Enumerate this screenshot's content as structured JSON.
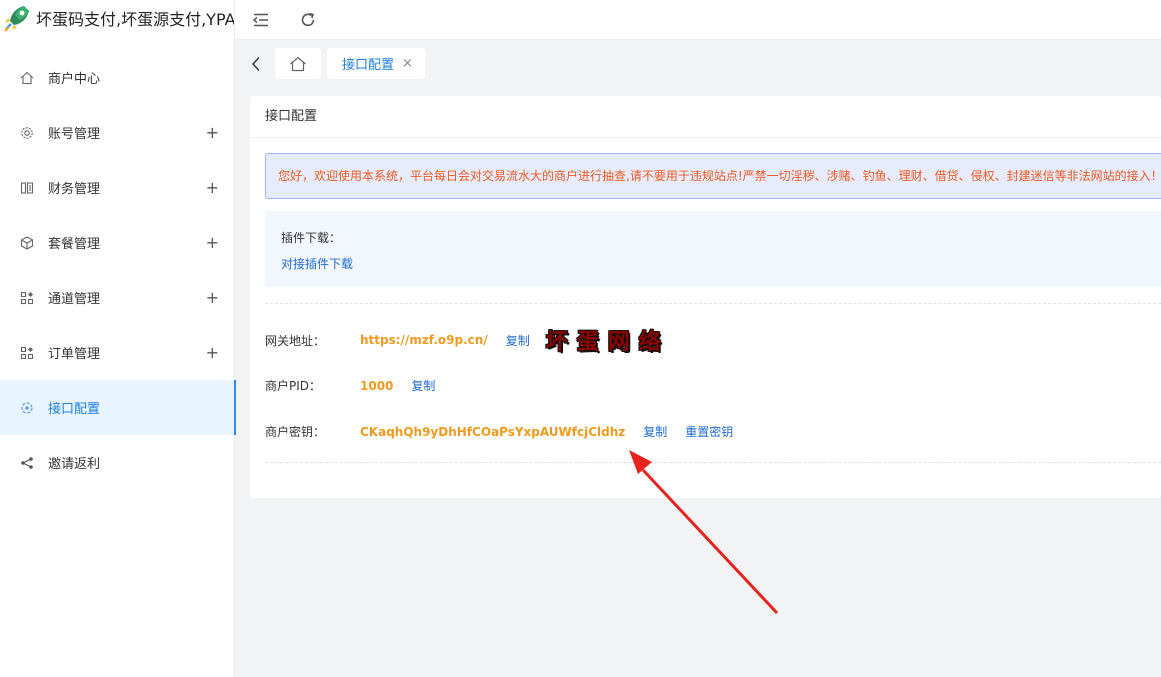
{
  "app": {
    "title": "坏蛋码支付,坏蛋源支付,YPA"
  },
  "sidebar": {
    "items": [
      {
        "label": "商户中心",
        "icon": "home-icon",
        "expandable": false,
        "active": false
      },
      {
        "label": "账号管理",
        "icon": "gear-icon",
        "expandable": true,
        "active": false
      },
      {
        "label": "财务管理",
        "icon": "finance-icon",
        "expandable": true,
        "active": false
      },
      {
        "label": "套餐管理",
        "icon": "package-icon",
        "expandable": true,
        "active": false
      },
      {
        "label": "通道管理",
        "icon": "grid-icon",
        "expandable": true,
        "active": false
      },
      {
        "label": "订单管理",
        "icon": "grid-icon",
        "expandable": true,
        "active": false
      },
      {
        "label": "接口配置",
        "icon": "api-icon",
        "expandable": false,
        "active": true
      },
      {
        "label": "邀请返利",
        "icon": "share-icon",
        "expandable": false,
        "active": false
      }
    ],
    "expand_glyph": "+"
  },
  "tabs": {
    "active_label": "接口配置",
    "close_glyph": "×"
  },
  "card": {
    "title": "接口配置",
    "notice": "您好，欢迎使用本系统，平台每日会对交易流水大的商户进行抽查,请不要用于违规站点!严禁一切淫秽、涉赌、钓鱼、理财、借贷、侵权、封建迷信等非法网站的接入！",
    "plugin_label": "插件下载：",
    "plugin_link": "对接插件下载",
    "gateway": {
      "label": "网关地址：",
      "value": "https://mzf.o9p.cn/",
      "copy_label": "复制",
      "watermark": "坏蛋网络"
    },
    "pid": {
      "label": "商户PID：",
      "value": "1000",
      "copy_label": "复制"
    },
    "key": {
      "label": "商户密钥：",
      "value": "CKaqhQh9yDhHfCOaPsYxpAUWfcjCldhz",
      "copy_label": "复制",
      "reset_label": "重置密钥"
    }
  },
  "colors": {
    "accent": "#1e7fe0",
    "notice_text": "#f05a24",
    "value_text": "#f39a1e",
    "arrow": "#e8231e"
  }
}
